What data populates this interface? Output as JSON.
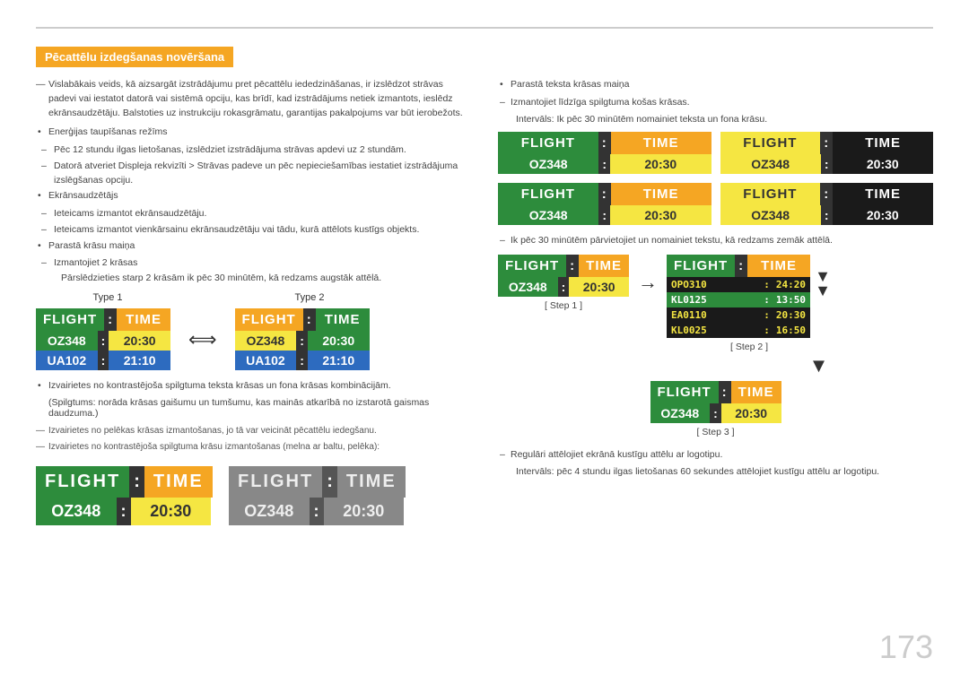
{
  "page": {
    "number": "173",
    "top_line": true
  },
  "section_title": "Pēcattēlu izdegšanas novēršana",
  "left_column": {
    "intro_text": "Vislabākais veids, kā aizsargāt izstrādājumu pret pēcattēlu iededzināšanas, ir izslēdzot strāvas padevi vai iestatot datorā vai sistēmā opciju, kas brīdī, kad izstrādājums netiek izmantots, ieslēdz ekrānsaudzētāju. Balstoties uz instrukciju rokasgrāmatu, garantijas pakalpojums var būt ierobežots.",
    "bullet1": "Enerģijas taupīšanas režīms",
    "bullet1_text": "Enerģijas taupīšanas režīms",
    "dash1": "Pēc 12 stundu ilgas lietošanas, izslēdziet izstrādājuma strāvas apdevi uz 2 stundām.",
    "dash2": "Datorā atveriet Displeja rekvizīti > Strāvas padeve un pēc nepieciešamības iestatiet izstrādājuma izslēgšanas opciju.",
    "bullet2": "Ekrānsaudzētājs",
    "dash3": "Ieteicams izmantot ekrānsaudzētāju.",
    "dash4": "Ieteicams izmantot vienkārsainu ekrānsaudzētāju vai tādu, kurā attēlots kustīgs objekts.",
    "bullet3": "Parastā krāsu maiņa",
    "dash5": "Izmantojiet 2 krāsas",
    "dash5_sub": "Pārslēdzieties starp 2 krāsām ik pēc 30 minūtēm, kā redzams augstāk attēlā.",
    "type_labels": [
      "Type 1",
      "Type 2"
    ],
    "boards_type1": {
      "header_left": "FLIGHT",
      "header_colon": ":",
      "header_right": "TIME",
      "row1_left": "OZ348",
      "row1_colon": ":",
      "row1_right": "20:30",
      "row2_left": "UA102",
      "row2_colon": ":",
      "row2_right": "21:10"
    },
    "boards_type2": {
      "header_left": "FLIGHT",
      "header_colon": ":",
      "header_right": "TIME",
      "row1_left": "OZ348",
      "row1_colon": ":",
      "row1_right": "20:30",
      "row2_left": "UA102",
      "row2_colon": ":",
      "row2_right": "21:10"
    },
    "bullet4": "Izvairietes no kontrastējoša spilgtuma teksta krāsas un fona krāsas kombinācijām.",
    "bullet4_sub": "(Spilgtums: norāda krāsas gaišumu un tumšumu, kas mainās atkarībā no izstarotā gaismas daudzuma.)",
    "dash_gray1": "Izvairietes no pelēkas krāsas izmantošanas, jo tā var veicināt pēcattēlu iedegšanu.",
    "dash_gray2": "Izvairietes no kontrastējoša spilgtuma krāsu izmantošanas (melna ar baltu, pelēka):",
    "bottom_board1": {
      "header_left": "FLIGHT",
      "header_colon": ":",
      "header_right": "TIME",
      "row1_left": "OZ348",
      "row1_colon": ":",
      "row1_right": "20:30"
    },
    "bottom_board2": {
      "header_left": "FLIGHT",
      "header_colon": ":",
      "header_right": "TIME",
      "row1_left": "OZ348",
      "row1_colon": ":",
      "row1_right": "20:30"
    }
  },
  "right_column": {
    "bullet1": "Parastā teksta krāsas maiņa",
    "dash1": "Izmantojiet līdzīga spilgtuma košas krāsas.",
    "dash1_sub": "Intervāls: Ik pēc 30 minūtēm nomainiet teksta un fona krāsu.",
    "boards_row1": [
      {
        "header_left": "FLIGHT",
        "header_colon": ":",
        "header_right": "TIME",
        "row1_left": "OZ348",
        "row1_colon": ":",
        "row1_right": "20:30",
        "theme": "green-yellow"
      },
      {
        "header_left": "FLIGHT",
        "header_colon": ":",
        "header_right": "TIME",
        "row1_left": "OZ348",
        "row1_colon": ":",
        "row1_right": "20:30",
        "theme": "yellow-dark"
      }
    ],
    "boards_row2": [
      {
        "header_left": "FLIGHT",
        "header_colon": ":",
        "header_right": "TIME",
        "row1_left": "OZ348",
        "row1_colon": ":",
        "row1_right": "20:30",
        "theme": "green-yellow"
      },
      {
        "header_left": "FLIGHT",
        "header_colon": ":",
        "header_right": "TIME",
        "row1_left": "OZ348",
        "row1_colon": ":",
        "row1_right": "20:30",
        "theme": "yellow-dark"
      }
    ],
    "dash2": "Ik pēc 30 minūtēm pārvietojiet un nomainiet tekstu, kā redzams zemāk attēlā.",
    "step1_label": "[ Step 1 ]",
    "step2_label": "[ Step 2 ]",
    "step3_label": "[ Step 3 ]",
    "scroll_board": {
      "rows": [
        {
          "left": "OPO310",
          "colon": ":",
          "right": "24:20",
          "highlight": false
        },
        {
          "left": "KL0125",
          "colon": ":",
          "right": "13:50",
          "highlight": true
        },
        {
          "left": "EA0110",
          "colon": ":",
          "right": "20:30",
          "highlight": false
        },
        {
          "left": "KL0025",
          "colon": ":",
          "right": "16:50",
          "highlight": false
        }
      ]
    },
    "step3_board": {
      "header_left": "FLIGHT",
      "header_colon": ":",
      "header_right": "TIME",
      "row1_left": "OZ348",
      "row1_colon": ":",
      "row1_right": "20:30"
    },
    "dash3": "Regulāri attēlojiet ekrānā kustīgu attēlu ar logotipu.",
    "dash3_sub": "Intervāls: pēc 4 stundu ilgas lietošanas 60 sekundes attēlojiet kustīgu attēlu ar logotipu."
  }
}
